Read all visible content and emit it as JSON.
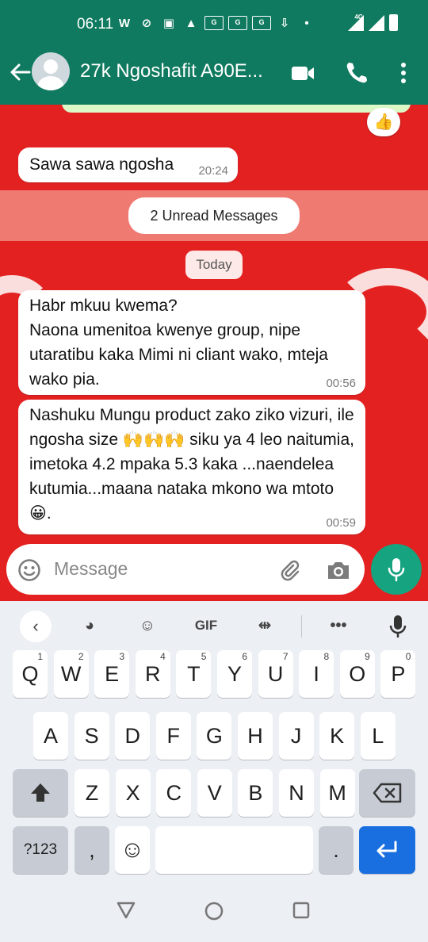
{
  "status_bar": {
    "time": "06:11",
    "network": "4G",
    "boxed_icons": [
      "G",
      "G",
      "G"
    ]
  },
  "header": {
    "contact_name": "27k Ngoshafit A90E..."
  },
  "chat": {
    "previous_reaction": "👍",
    "messages_before": [
      {
        "text": "Sawa sawa ngosha",
        "time": "20:24"
      }
    ],
    "unread_banner": "2 Unread Messages",
    "date_chip": "Today",
    "messages_after": [
      {
        "text": "Habr mkuu kwema?\nNaona umenitoa kwenye group, nipe utaratibu kaka Mimi ni cliant wako, mteja wako pia.",
        "time": "00:56"
      },
      {
        "text": "Nashuku Mungu product zako ziko vizuri, ile ngosha size 🙌🙌🙌 siku ya 4 leo naitumia, imetoka 4.2 mpaka 5.3 kaka ...naendelea kutumia...maana nataka mkono wa mtoto 😀.",
        "time": "00:59"
      }
    ]
  },
  "composer": {
    "placeholder": "Message"
  },
  "keyboard": {
    "toolbar": {
      "gif": "GIF"
    },
    "row1": [
      {
        "k": "Q",
        "n": "1"
      },
      {
        "k": "W",
        "n": "2"
      },
      {
        "k": "E",
        "n": "3"
      },
      {
        "k": "R",
        "n": "4"
      },
      {
        "k": "T",
        "n": "5"
      },
      {
        "k": "Y",
        "n": "6"
      },
      {
        "k": "U",
        "n": "7"
      },
      {
        "k": "I",
        "n": "8"
      },
      {
        "k": "O",
        "n": "9"
      },
      {
        "k": "P",
        "n": "0"
      }
    ],
    "row2": [
      "A",
      "S",
      "D",
      "F",
      "G",
      "H",
      "J",
      "K",
      "L"
    ],
    "row3": [
      "Z",
      "X",
      "C",
      "V",
      "B",
      "N",
      "M"
    ],
    "row4": {
      "symbols": "?123",
      "comma": ",",
      "emoji": "☺",
      "period": "."
    }
  },
  "colors": {
    "header_bg": "#0f7a5f",
    "chat_bg": "#e32121",
    "mic_bg": "#16a37f",
    "enter_key": "#1a6fe0"
  }
}
